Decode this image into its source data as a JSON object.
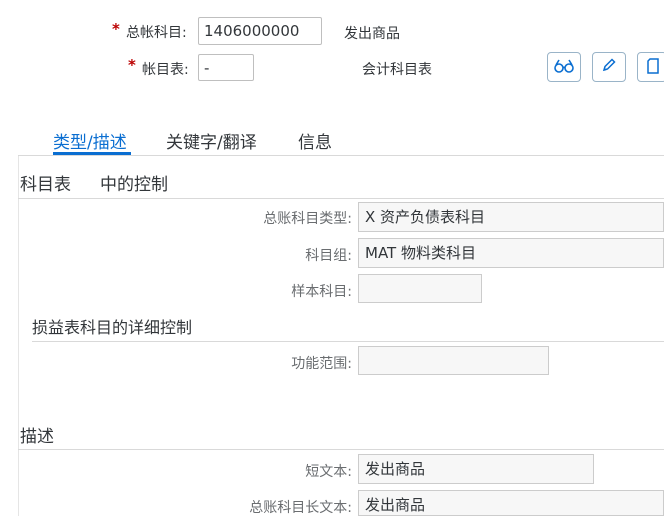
{
  "header": {
    "gl_account": {
      "required_mark": "*",
      "label": "总帐科目:",
      "value": "1406000000",
      "description": "发出商品"
    },
    "chart_of_accounts": {
      "required_mark": "*",
      "label": "帐目表:",
      "value": "-",
      "description": "会计科目表"
    }
  },
  "toolbar": {
    "display_icon": "glasses-icon",
    "edit_icon": "pencil-icon",
    "copy_icon": "copy-icon"
  },
  "tabs": [
    {
      "label": "类型/描述",
      "active": true
    },
    {
      "label": "关键字/翻译",
      "active": false
    },
    {
      "label": "信息",
      "active": false
    }
  ],
  "control": {
    "title_part1": "科目表",
    "title_part2": "中的控制",
    "fields": {
      "account_type": {
        "label": "总账科目类型:",
        "value": "X 资产负债表科目"
      },
      "account_group": {
        "label": "科目组:",
        "value": "MAT 物料类科目"
      },
      "sample_account": {
        "label": "样本科目:",
        "value": ""
      }
    }
  },
  "pl_detail": {
    "title": "损益表科目的详细控制",
    "functional_area": {
      "label": "功能范围:",
      "value": ""
    }
  },
  "description": {
    "title": "描述",
    "short_text": {
      "label": "短文本:",
      "value": "发出商品"
    },
    "long_text": {
      "label": "总账科目长文本:",
      "value": "发出商品"
    }
  },
  "colors": {
    "accent": "#0a6ed1",
    "required": "#bb0000"
  }
}
